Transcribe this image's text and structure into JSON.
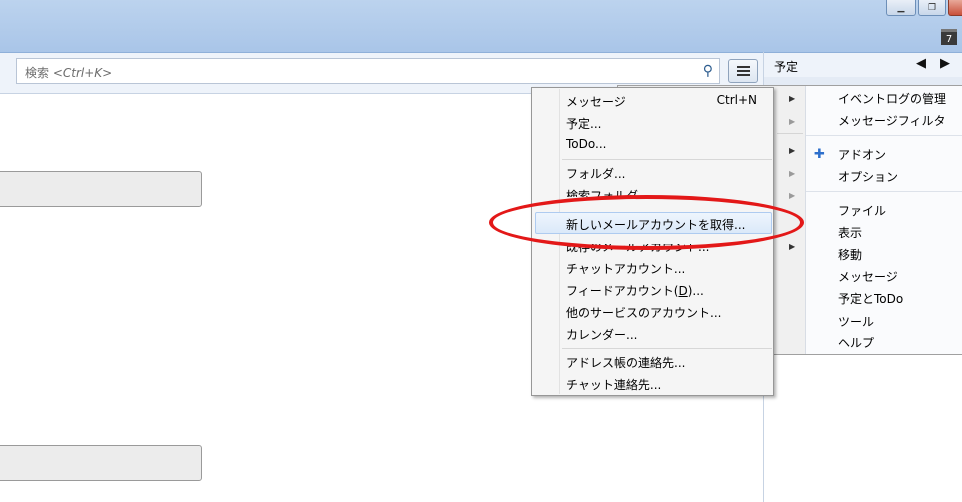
{
  "window": {
    "minimize_glyph": "▁",
    "restore_glyph": "❐",
    "calendar_icon_text": "7"
  },
  "search": {
    "placeholder_prefix": "検索 <",
    "placeholder_shortcut": "Ctrl+K",
    "placeholder_suffix": ">"
  },
  "calendar_pane": {
    "title": "予定",
    "prev": "◀",
    "next": "▶"
  },
  "submenu": {
    "items": [
      {
        "label": "メッセージ",
        "shortcut": "Ctrl+N"
      },
      {
        "label": "予定..."
      },
      {
        "label": "ToDo..."
      },
      {
        "label": "フォルダ..."
      },
      {
        "label": "検索フォルダ..."
      },
      {
        "label": "新しいメールアカウントを取得..."
      },
      {
        "label": "既存のメールアカウント..."
      },
      {
        "label": "チャットアカウント..."
      },
      {
        "label_pre": "フィードアカウント(",
        "label_key": "D",
        "label_post": ")..."
      },
      {
        "label": "他のサービスのアカウント..."
      },
      {
        "label": "カレンダー..."
      },
      {
        "label": "アドレス帳の連絡先..."
      },
      {
        "label": "チャット連絡先..."
      }
    ]
  },
  "main_menu": {
    "items": [
      "イベントログの管理",
      "メッセージフィルタ",
      "アドオン",
      "オプション",
      "ファイル",
      "表示",
      "移動",
      "メッセージ",
      "予定とToDo",
      "ツール",
      "ヘルプ"
    ]
  },
  "icons": {
    "search": "search-icon",
    "menu": "hamburger-menu-icon",
    "addon": "puzzle-icon",
    "calendar": "calendar-icon"
  },
  "colors": {
    "highlight_ellipse": "#e31818",
    "titlebar": "#a9c5e8"
  }
}
